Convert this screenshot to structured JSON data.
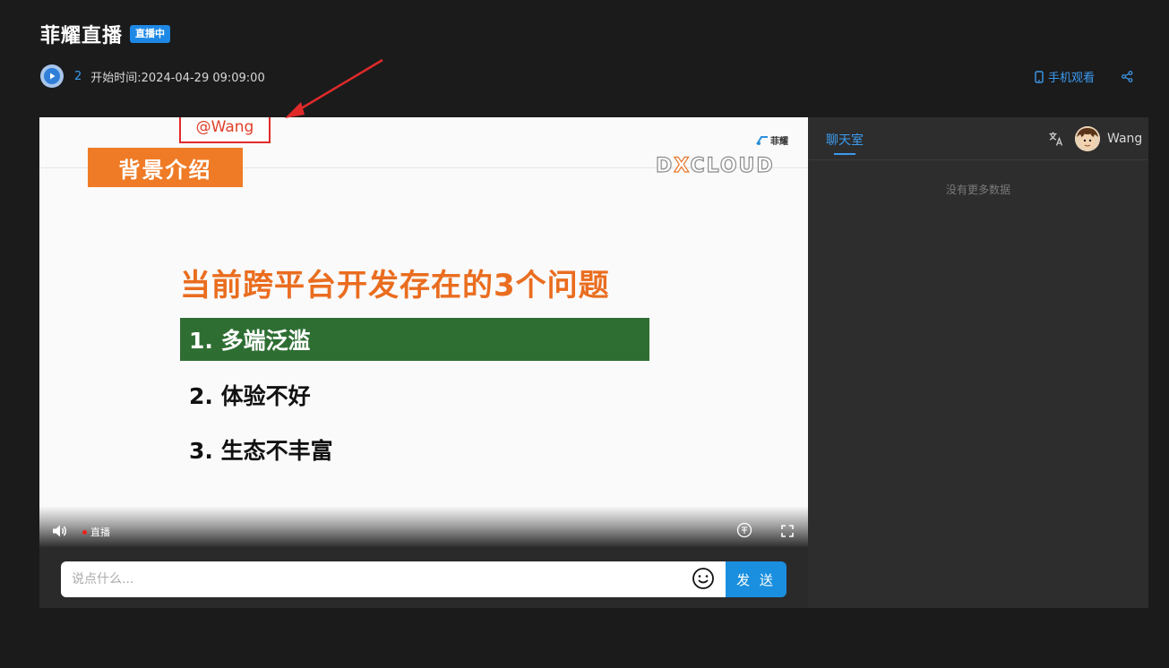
{
  "header": {
    "title": "菲耀直播",
    "badge": "直播中",
    "viewer_count": "2",
    "start_time": "开始时间:2024-04-29 09:09:00",
    "mobile_watch": "手机观看"
  },
  "slide": {
    "tag": "背景介绍",
    "brand_text": "菲耀",
    "dcloud_x": "X",
    "dcloud_rest": "CLOUD",
    "dcloud_d": "D",
    "heading": "当前跨平台开发存在的3个问题",
    "items": [
      "1. 多端泛滥",
      "2. 体验不好",
      "3. 生态不丰富"
    ]
  },
  "watermark": "@Wang",
  "player_controls": {
    "live_label": "直播"
  },
  "chat_input": {
    "placeholder": "说点什么...",
    "send_label": "发 送"
  },
  "chat_panel": {
    "tab": "聊天室",
    "username": "Wang",
    "empty_text": "没有更多数据"
  },
  "colors": {
    "accent": "#1e88e5",
    "slide_orange": "#ef7b26",
    "slide_green": "#2f6e33",
    "annotation_red": "#e02a2a"
  }
}
